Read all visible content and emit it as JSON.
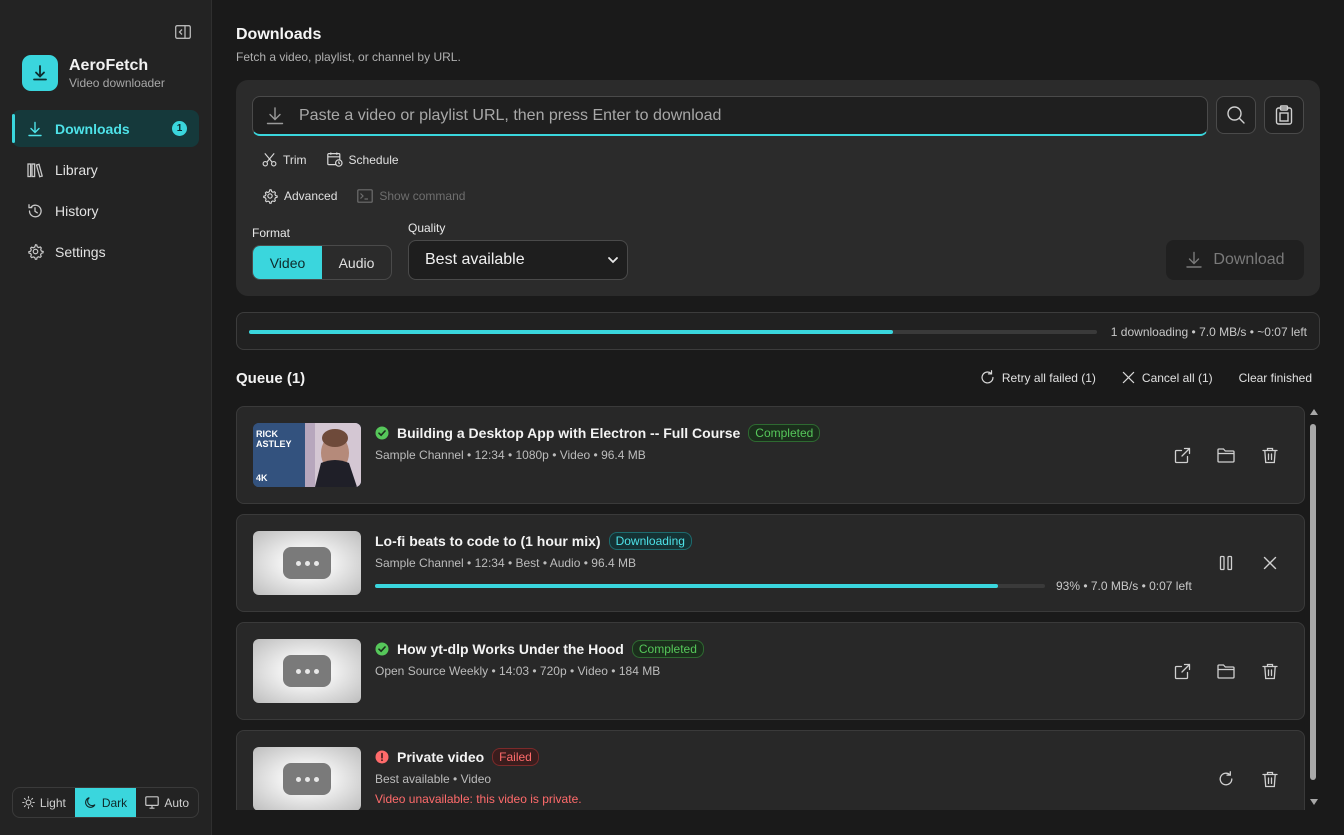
{
  "app": {
    "name": "AeroFetch",
    "subtitle": "Video downloader"
  },
  "sidebar": {
    "items": [
      {
        "label": "Downloads",
        "icon": "download-icon",
        "badge": "1",
        "active": true
      },
      {
        "label": "Library",
        "icon": "library-icon"
      },
      {
        "label": "History",
        "icon": "history-icon"
      },
      {
        "label": "Settings",
        "icon": "gear-icon"
      }
    ],
    "theme": {
      "options": [
        "Light",
        "Dark",
        "Auto"
      ],
      "selected": "Dark"
    }
  },
  "page": {
    "title": "Downloads",
    "subtitle": "Fetch a video, playlist, or channel by URL."
  },
  "fetch": {
    "url_value": "",
    "url_placeholder": "Paste a video or playlist URL, then press Enter to download",
    "options": {
      "trim": "Trim",
      "schedule": "Schedule",
      "advanced": "Advanced",
      "show_command": "Show command"
    },
    "format_label": "Format",
    "format_options": [
      "Video",
      "Audio"
    ],
    "format_selected": "Video",
    "quality_label": "Quality",
    "quality_value": "Best available",
    "download_label": "Download"
  },
  "overall": {
    "progress": 0.76,
    "status": "1 downloading • 7.0 MB/s • ~0:07 left"
  },
  "queue": {
    "title": "Queue (1)",
    "actions": {
      "retry": "Retry all failed (1)",
      "cancel": "Cancel all (1)",
      "clear": "Clear finished"
    },
    "items": [
      {
        "title": "Building a Desktop App with Electron -- Full Course",
        "status": "Completed",
        "meta": "Sample Channel • 12:34 • 1080p • Video • 96.4 MB",
        "thumb_text": [
          "RICK",
          "ASTLEY",
          "4K"
        ]
      },
      {
        "title": "Lo-fi beats to code to (1 hour mix)",
        "status": "Downloading",
        "meta": "Sample Channel • 12:34 • Best • Audio • 96.4 MB",
        "progress": 0.93,
        "progress_text": "93% • 7.0 MB/s • 0:07 left"
      },
      {
        "title": "How yt-dlp Works Under the Hood",
        "status": "Completed",
        "meta": "Open Source Weekly • 14:03 • 720p • Video • 184 MB"
      },
      {
        "title": "Private video",
        "status": "Failed",
        "meta": "Best available • Video",
        "error": "Video unavailable: this video is private."
      }
    ]
  },
  "colors": {
    "accent": "#3ad6dd",
    "success": "#56c75a",
    "error": "#ff6b6b",
    "background": "#1a1a1a",
    "sidebar": "#232323"
  }
}
